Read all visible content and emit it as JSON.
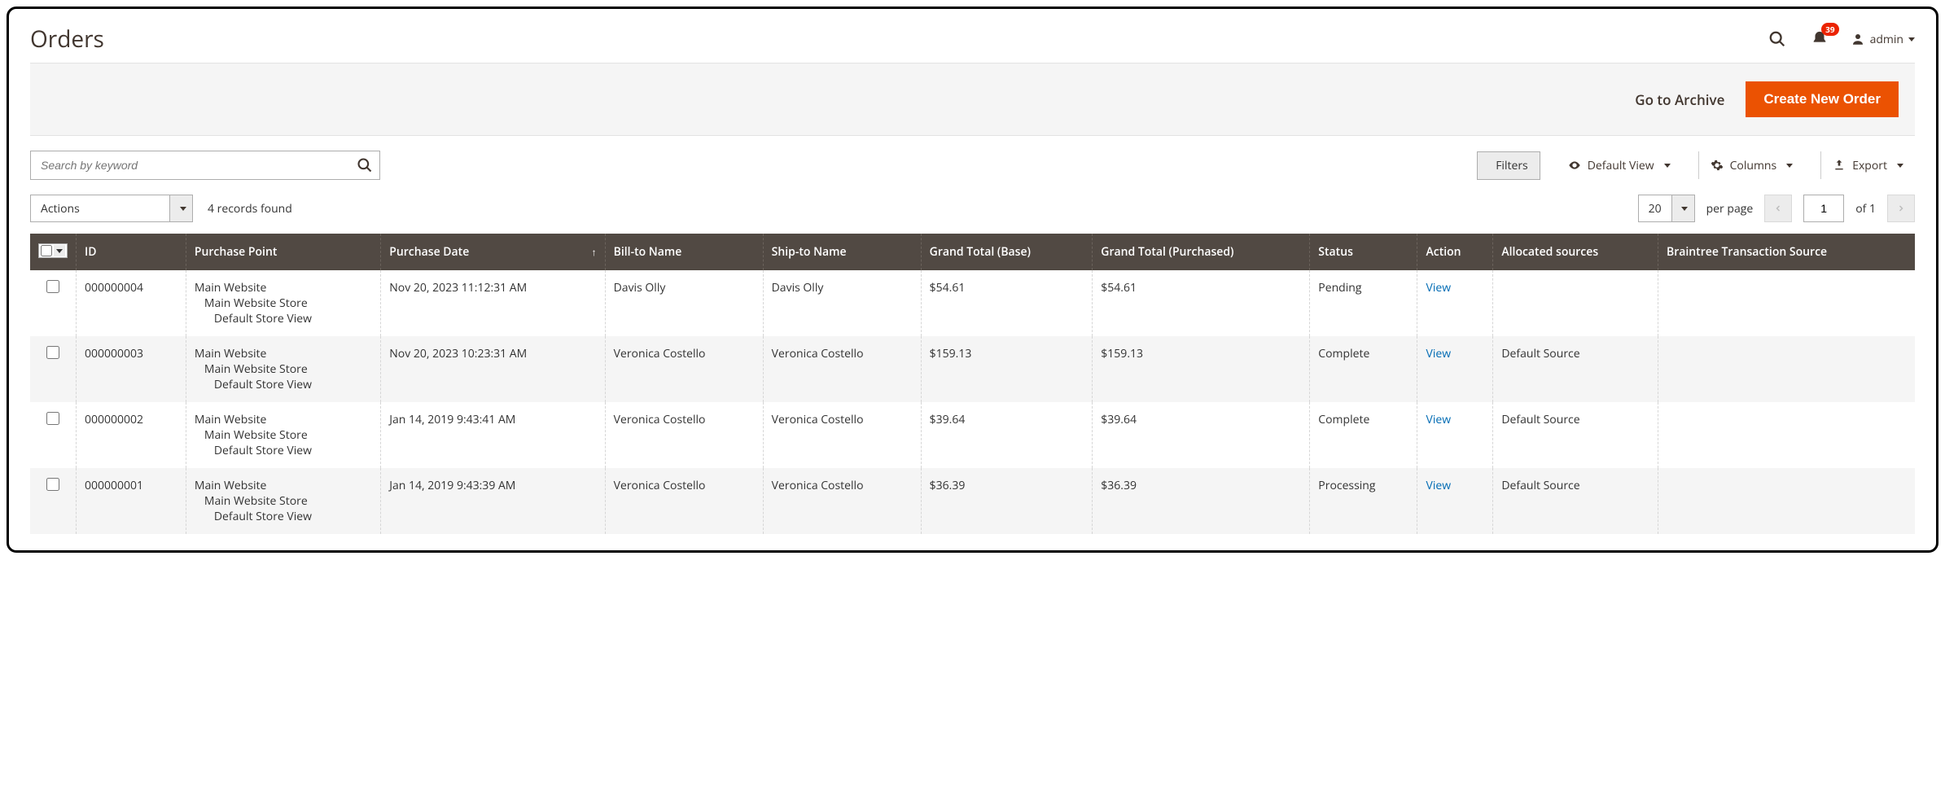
{
  "header": {
    "title": "Orders",
    "notification_count": "39",
    "user_label": "admin"
  },
  "action_bar": {
    "archive_label": "Go to Archive",
    "create_label": "Create New Order"
  },
  "search": {
    "placeholder": "Search by keyword"
  },
  "toolbar": {
    "filters_label": "Filters",
    "default_view_label": "Default View",
    "columns_label": "Columns",
    "export_label": "Export"
  },
  "grid_controls": {
    "actions_label": "Actions",
    "records_found": "4 records found",
    "page_size": "20",
    "per_page_label": "per page",
    "current_page": "1",
    "of_label": "of",
    "total_pages": "1"
  },
  "columns": {
    "id": "ID",
    "purchase_point": "Purchase Point",
    "purchase_date": "Purchase Date",
    "bill_to": "Bill-to Name",
    "ship_to": "Ship-to Name",
    "grand_total_base": "Grand Total (Base)",
    "grand_total_purchased": "Grand Total (Purchased)",
    "status": "Status",
    "action": "Action",
    "allocated_sources": "Allocated sources",
    "braintree": "Braintree Transaction Source"
  },
  "purchase_point": {
    "line1": "Main Website",
    "line2": "Main Website Store",
    "line3": "Default Store View"
  },
  "view_label": "View",
  "rows": [
    {
      "id": "000000004",
      "date": "Nov 20, 2023 11:12:31 AM",
      "bill_to": "Davis Olly",
      "ship_to": "Davis Olly",
      "gt_base": "$54.61",
      "gt_purchased": "$54.61",
      "status": "Pending",
      "allocated": "",
      "braintree": ""
    },
    {
      "id": "000000003",
      "date": "Nov 20, 2023 10:23:31 AM",
      "bill_to": "Veronica Costello",
      "ship_to": "Veronica Costello",
      "gt_base": "$159.13",
      "gt_purchased": "$159.13",
      "status": "Complete",
      "allocated": "Default Source",
      "braintree": ""
    },
    {
      "id": "000000002",
      "date": "Jan 14, 2019 9:43:41 AM",
      "bill_to": "Veronica Costello",
      "ship_to": "Veronica Costello",
      "gt_base": "$39.64",
      "gt_purchased": "$39.64",
      "status": "Complete",
      "allocated": "Default Source",
      "braintree": ""
    },
    {
      "id": "000000001",
      "date": "Jan 14, 2019 9:43:39 AM",
      "bill_to": "Veronica Costello",
      "ship_to": "Veronica Costello",
      "gt_base": "$36.39",
      "gt_purchased": "$36.39",
      "status": "Processing",
      "allocated": "Default Source",
      "braintree": ""
    }
  ]
}
